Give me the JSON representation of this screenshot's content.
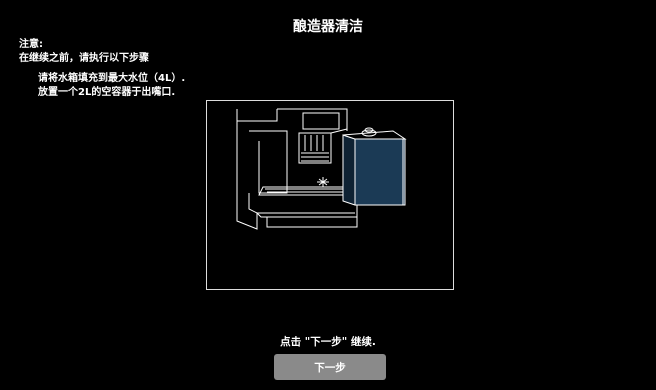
{
  "header": {
    "title": "酿造器清洁"
  },
  "notice": {
    "label": "注意:",
    "intro": "在继续之前，请执行以下步骤",
    "steps": [
      "请将水箱填充到最大水位（4L）.",
      "放置一个2L的空容器于出嘴口."
    ]
  },
  "illustration": {
    "subject": "coffee-machine-with-container-icon",
    "colors": {
      "container": "#1b3a55",
      "line": "#ffffff",
      "background": "#000000"
    }
  },
  "footer": {
    "hint": "点击 \"下一步\" 继续.",
    "next_label": "下一步",
    "button_color": "#8a8a8a"
  }
}
